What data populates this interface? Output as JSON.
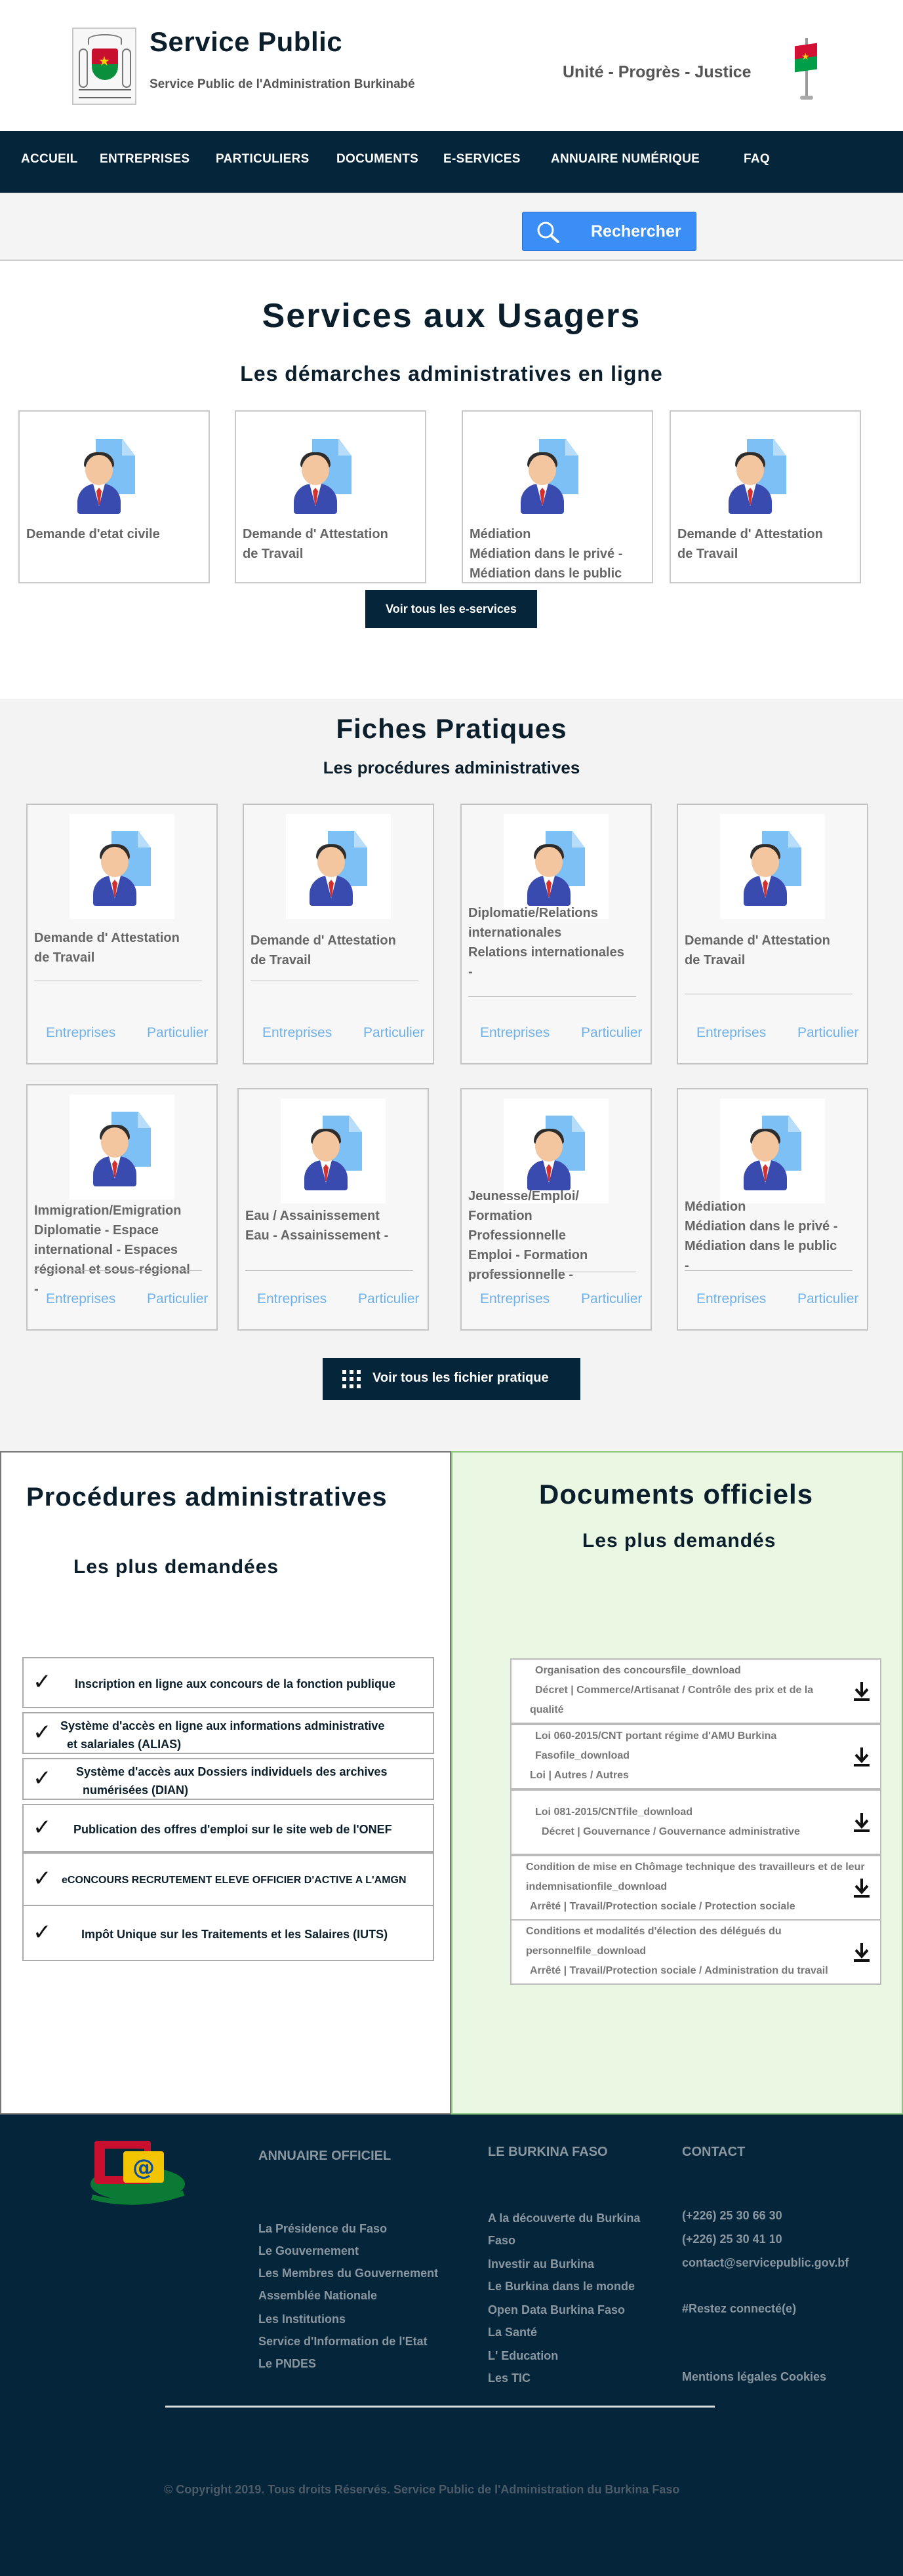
{
  "header": {
    "title": "Service Public",
    "subtitle": "Service Public de l'Administration Burkinabé",
    "motto": "Unité - Progrès - Justice"
  },
  "nav": {
    "items": [
      "ACCUEIL",
      "ENTREPRISES",
      "PARTICULIERS",
      "DOCUMENTS",
      "E-SERVICES",
      "ANNUAIRE NUMÉRIQUE",
      "FAQ"
    ]
  },
  "search": {
    "button_label": "Rechercher"
  },
  "services": {
    "title": "Services aux Usagers",
    "subtitle": "Les démarches administratives en ligne",
    "cards": [
      {
        "lines": [
          "Demande d'etat civile"
        ]
      },
      {
        "lines": [
          "Demande d' Attestation",
          "de Travail"
        ]
      },
      {
        "lines": [
          "Médiation",
          "Médiation dans le privé -",
          "Médiation dans le public"
        ]
      },
      {
        "lines": [
          "Demande d' Attestation",
          "de Travail"
        ]
      }
    ],
    "button_label": "Voir tous les e-services"
  },
  "fiches": {
    "title": "Fiches Pratiques",
    "subtitle": "Les procédures administratives",
    "cards": [
      {
        "lines": [
          "Demande d' Attestation",
          "de Travail"
        ],
        "links": [
          "Entreprises",
          "Particulier"
        ]
      },
      {
        "lines": [
          "Demande d' Attestation",
          "de Travail"
        ],
        "links": [
          "Entreprises",
          "Particulier"
        ]
      },
      {
        "lines": [
          "Diplomatie/Relations",
          "internationales",
          "Relations internationales",
          "-"
        ],
        "links": [
          "Entreprises",
          "Particulier"
        ]
      },
      {
        "lines": [
          "Demande d' Attestation",
          "de Travail"
        ],
        "links": [
          "Entreprises",
          "Particulier"
        ]
      },
      {
        "lines": [
          "Immigration/Emigration",
          "Diplomatie - Espace",
          "international - Espaces",
          "régional et sous-régional",
          "-"
        ],
        "links": [
          "Entreprises",
          "Particulier"
        ]
      },
      {
        "lines": [
          "Eau / Assainissement",
          "Eau - Assainissement -"
        ],
        "links": [
          "Entreprises",
          "Particulier"
        ]
      },
      {
        "lines": [
          "Jeunesse/Emploi/",
          "Formation",
          "Professionnelle",
          "Emploi - Formation",
          "professionnelle -"
        ],
        "links": [
          "Entreprises",
          "Particulier"
        ]
      },
      {
        "lines": [
          "Médiation",
          "Médiation dans le privé -",
          "Médiation dans le public",
          "-"
        ],
        "links": [
          "Entreprises",
          "Particulier"
        ]
      }
    ],
    "button_label": "Voir tous les fichier pratique"
  },
  "procedures": {
    "title": "Procédures administratives",
    "subtitle": "Les plus demandées",
    "items": [
      {
        "lines": [
          "Inscription en ligne aux concours de la fonction publique"
        ]
      },
      {
        "lines": [
          "Système d'accès en ligne aux informations administrative",
          "et salariales (ALIAS)"
        ]
      },
      {
        "lines": [
          "Système d'accès aux Dossiers individuels des archives",
          "numérisées (DIAN)"
        ]
      },
      {
        "lines": [
          "Publication des offres d'emploi sur le site web de l'ONEF"
        ]
      },
      {
        "lines": [
          "eCONCOURS RECRUTEMENT ELEVE OFFICIER D'ACTIVE A L'AMGN"
        ]
      },
      {
        "lines": [
          "Impôt Unique sur les Traitements et les Salaires (IUTS)"
        ]
      }
    ]
  },
  "documents": {
    "title": "Documents officiels",
    "subtitle": "Les plus demandés",
    "items": [
      {
        "lines": [
          "Organisation des concoursfile_download",
          "Décret | Commerce/Artisanat / Contrôle des prix et de la",
          "qualité"
        ]
      },
      {
        "lines": [
          "Loi 060-2015/CNT portant régime d'AMU Burkina",
          "Fasofile_download",
          "Loi | Autres / Autres"
        ]
      },
      {
        "lines": [
          "Loi 081-2015/CNTfile_download",
          "Décret | Gouvernance / Gouvernance administrative"
        ]
      },
      {
        "lines": [
          "Condition de mise en Chômage technique des travailleurs et de leur",
          "indemnisationfile_download",
          "Arrêté | Travail/Protection sociale / Protection sociale"
        ]
      },
      {
        "lines": [
          "Conditions et modalités d'élection des délégués du",
          "personnelfile_download",
          "Arrêté | Travail/Protection sociale / Administration du travail"
        ]
      }
    ]
  },
  "footer": {
    "annuaire": {
      "title": "ANNUAIRE OFFICIEL",
      "links": [
        "La Présidence du Faso",
        "Le Gouvernement",
        "Les Membres du Gouvernement",
        "Assemblée Nationale",
        "Les Institutions",
        "Service d'Information de l'Etat",
        "Le PNDES"
      ]
    },
    "burkina": {
      "title": "LE BURKINA FASO",
      "links": [
        "A la découverte du Burkina",
        "Faso",
        "Investir au Burkina",
        "Le Burkina dans le monde",
        "Open Data Burkina Faso",
        "La Santé",
        "L' Education",
        "Les TIC"
      ]
    },
    "contact": {
      "title": "CONTACT",
      "phone1": "(+226) 25 30 66 30",
      "phone2": "(+226) 25 30 41 10",
      "email": "contact@servicepublic.gov.bf",
      "hashtag": "#Restez connecté(e)",
      "legal": "Mentions légales Cookies"
    },
    "copyright": "© Copyright 2019. Tous droits Réservés. Service Public de l'Administration du Burkina Faso"
  },
  "colors": {
    "primary_dark": "#04253a",
    "accent_blue": "#3a8ef6",
    "link_blue": "#6fb1ea",
    "docs_bg": "#e9f7e3"
  }
}
